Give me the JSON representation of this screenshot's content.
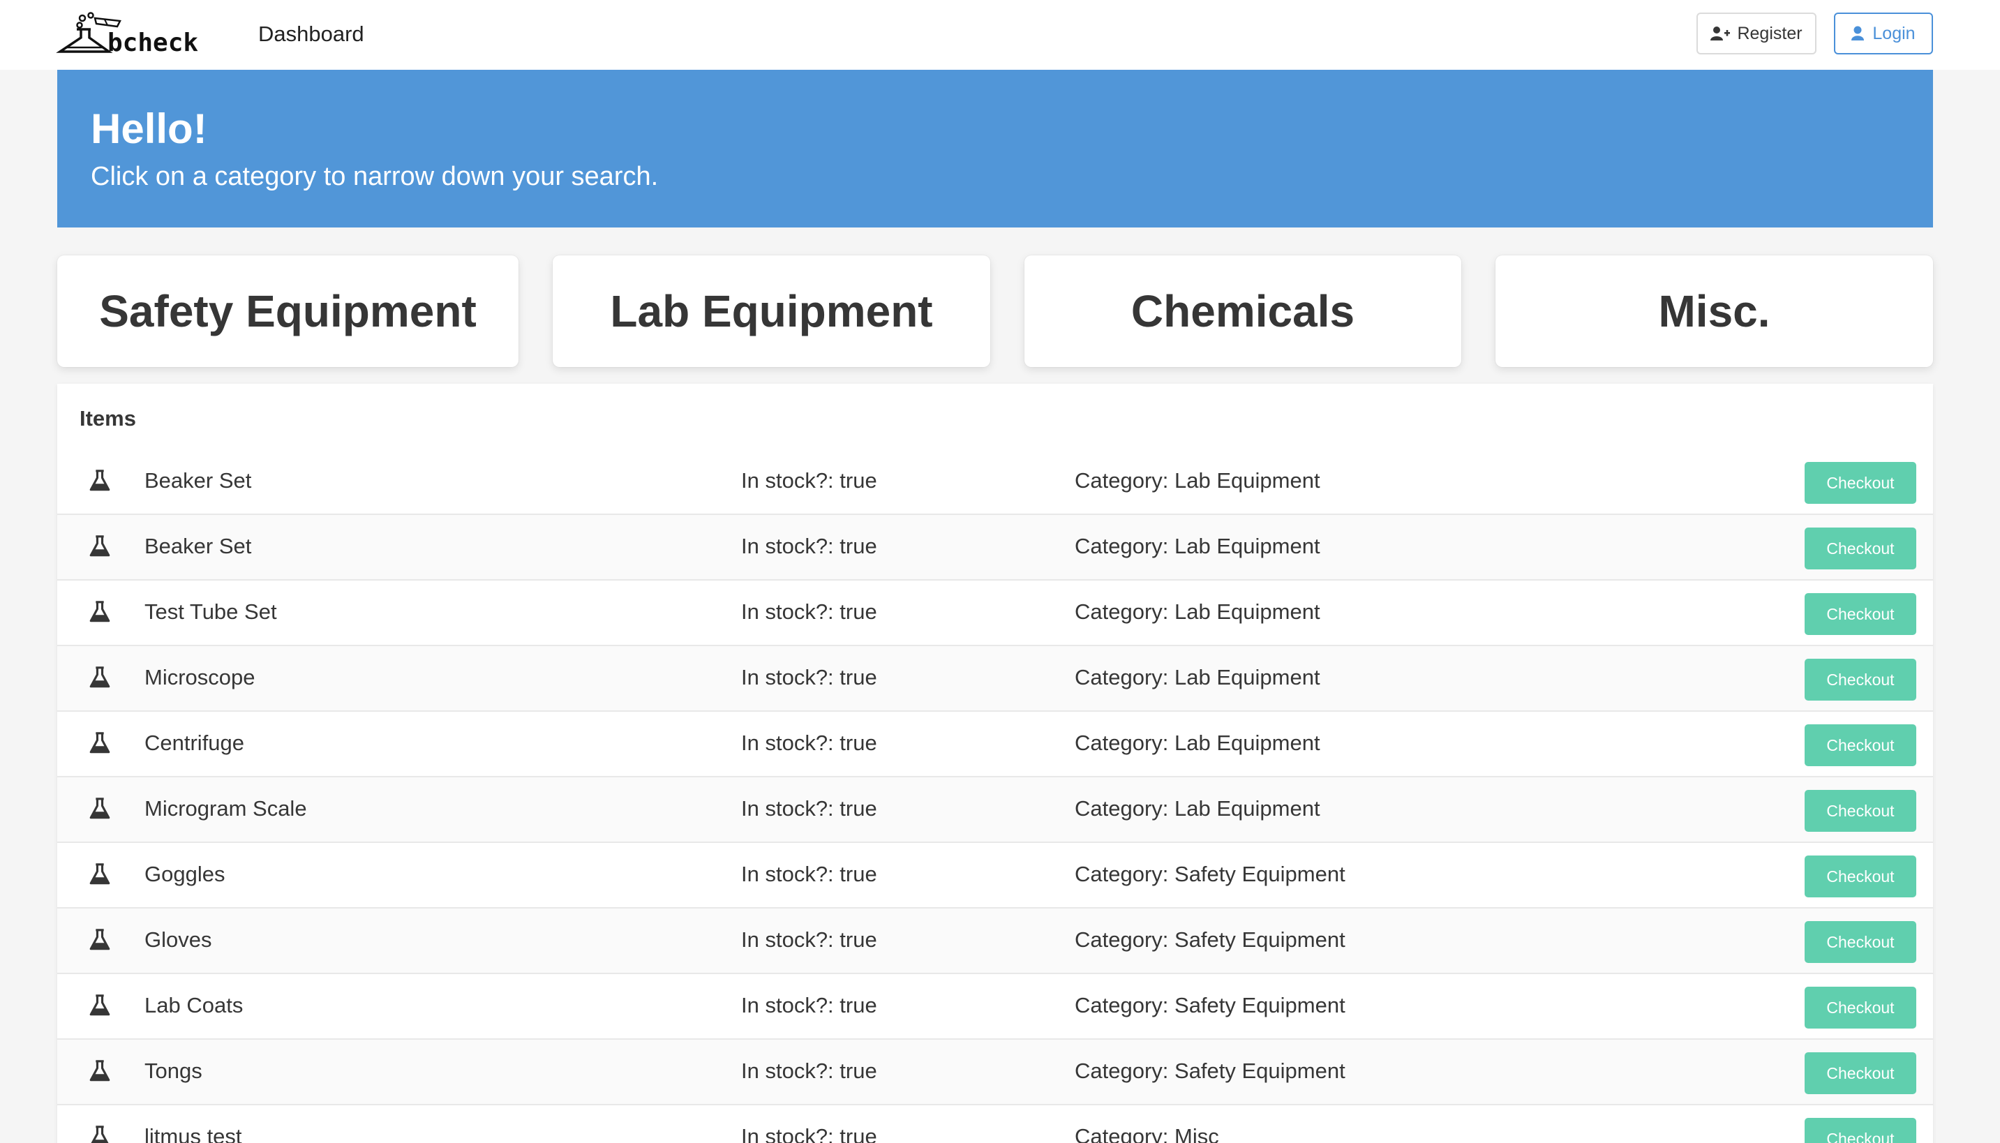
{
  "nav": {
    "logo_text": "bcheck",
    "dashboard_label": "Dashboard",
    "register_label": "Register",
    "login_label": "Login"
  },
  "hero": {
    "title": "Hello!",
    "subtitle": "Click on a category to narrow down your search."
  },
  "categories": [
    {
      "label": "Safety Equipment"
    },
    {
      "label": "Lab Equipment"
    },
    {
      "label": "Chemicals"
    },
    {
      "label": "Misc."
    }
  ],
  "items_panel": {
    "heading": "Items",
    "checkout_label": "Checkout",
    "items": [
      {
        "name": "Beaker Set",
        "stock": "In stock?: true",
        "category": "Category: Lab Equipment"
      },
      {
        "name": "Beaker Set",
        "stock": "In stock?: true",
        "category": "Category: Lab Equipment"
      },
      {
        "name": "Test Tube Set",
        "stock": "In stock?: true",
        "category": "Category: Lab Equipment"
      },
      {
        "name": "Microscope",
        "stock": "In stock?: true",
        "category": "Category: Lab Equipment"
      },
      {
        "name": "Centrifuge",
        "stock": "In stock?: true",
        "category": "Category: Lab Equipment"
      },
      {
        "name": "Microgram Scale",
        "stock": "In stock?: true",
        "category": "Category: Lab Equipment"
      },
      {
        "name": "Goggles",
        "stock": "In stock?: true",
        "category": "Category: Safety Equipment"
      },
      {
        "name": "Gloves",
        "stock": "In stock?: true",
        "category": "Category: Safety Equipment"
      },
      {
        "name": "Lab Coats",
        "stock": "In stock?: true",
        "category": "Category: Safety Equipment"
      },
      {
        "name": "Tongs",
        "stock": "In stock?: true",
        "category": "Category: Safety Equipment"
      },
      {
        "name": "litmus test",
        "stock": "In stock?: true",
        "category": "Category: Misc"
      }
    ]
  },
  "colors": {
    "hero_bg": "#5196d8",
    "checkout_bg": "#60cfae",
    "login_accent": "#4a90d9"
  }
}
